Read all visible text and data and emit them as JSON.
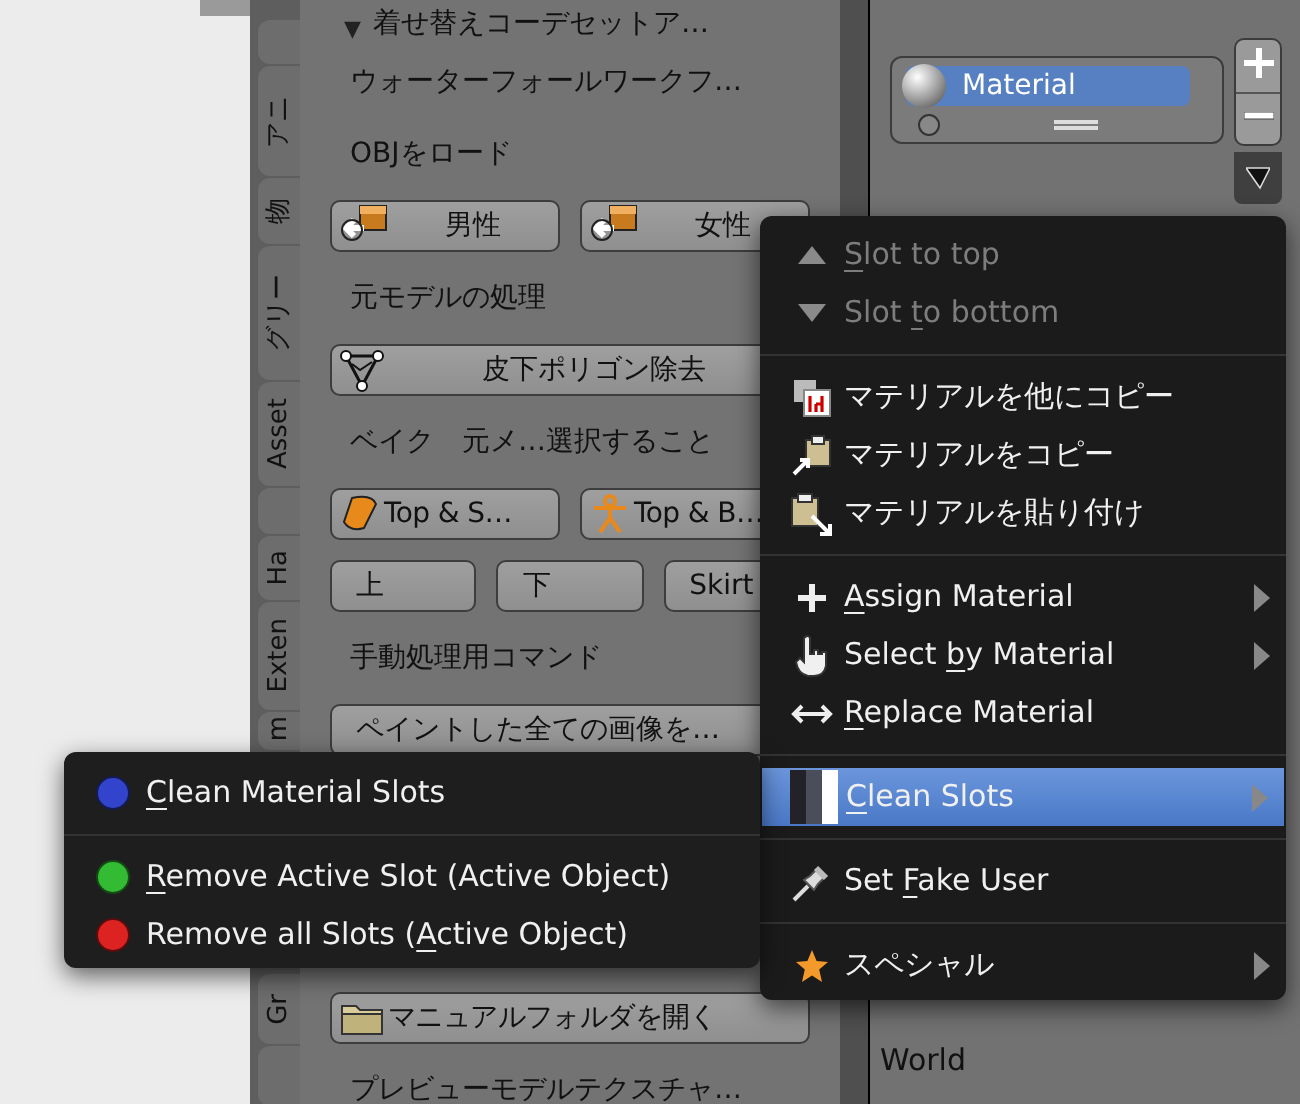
{
  "side_tabs": [
    {
      "kind": "blank"
    },
    {
      "kind": "labeled",
      "label": "アニ"
    },
    {
      "kind": "labeled",
      "label": "物"
    },
    {
      "kind": "labeled",
      "label": "グリー"
    },
    {
      "kind": "labeled",
      "label": "Asset"
    },
    {
      "kind": "blank"
    },
    {
      "kind": "labeled",
      "label": "Ha"
    },
    {
      "kind": "labeled",
      "label": "Exten"
    },
    {
      "kind": "labeled",
      "label": "m"
    },
    {
      "kind": "labeled",
      "label": "Gr"
    },
    {
      "kind": "blank"
    }
  ],
  "panel": {
    "top_rows": [
      {
        "kind": "header",
        "arrow": "▼",
        "text": "着せ替えコーデセットア…"
      },
      {
        "kind": "label",
        "text": "ウォーターフォールワークフ…"
      },
      {
        "kind": "label",
        "text": "OBJをロード"
      },
      {
        "kind": "buttons",
        "buttons": [
          {
            "label": "男性"
          },
          {
            "label": "女性"
          }
        ]
      },
      {
        "kind": "label",
        "text": "元モデルの処理"
      },
      {
        "kind": "buttons",
        "buttons": [
          {
            "label": "皮下ポリゴン除去"
          }
        ]
      },
      {
        "kind": "label",
        "text": "ベイク　元メ…選択すること"
      },
      {
        "kind": "buttons",
        "buttons": [
          {
            "label": "Top & S…"
          },
          {
            "label": "Top & B…"
          }
        ]
      },
      {
        "kind": "buttons",
        "buttons": [
          {
            "label": "上"
          },
          {
            "label": "下"
          },
          {
            "label": "Skirt"
          }
        ]
      },
      {
        "kind": "label",
        "text": "手動処理用コマンド"
      },
      {
        "kind": "buttons",
        "buttons": [
          {
            "label": "ペイントした全ての画像を…"
          }
        ]
      }
    ],
    "bottom_rows": [
      {
        "kind": "buttons",
        "buttons": [
          {
            "label": "マニュアルフォルダを開く"
          }
        ]
      },
      {
        "kind": "label",
        "text": "プレビューモデルテクスチャ…"
      }
    ]
  },
  "material_list": {
    "items": [
      {
        "name": "Material",
        "selected": true
      }
    ]
  },
  "world": "World",
  "context_menu": [
    {
      "kind": "item",
      "label": "Slot to top",
      "disabled": true,
      "submenu": false,
      "selected": false
    },
    {
      "kind": "item",
      "label": "Slot to bottom",
      "disabled": true,
      "submenu": false,
      "selected": false
    },
    {
      "kind": "separator"
    },
    {
      "kind": "item",
      "label": "マテリアルを他にコピー",
      "disabled": false,
      "submenu": false,
      "selected": false
    },
    {
      "kind": "item",
      "label": "マテリアルをコピー",
      "disabled": false,
      "submenu": false,
      "selected": false
    },
    {
      "kind": "item",
      "label": "マテリアルを貼り付け",
      "disabled": false,
      "submenu": false,
      "selected": false
    },
    {
      "kind": "separator"
    },
    {
      "kind": "item",
      "label": "Assign Material",
      "disabled": false,
      "submenu": true,
      "selected": false
    },
    {
      "kind": "item",
      "label": "Select by Material",
      "disabled": false,
      "submenu": true,
      "selected": false
    },
    {
      "kind": "item",
      "label": "Replace Material",
      "disabled": false,
      "submenu": false,
      "selected": false
    },
    {
      "kind": "separator"
    },
    {
      "kind": "item",
      "label": "Clean Slots",
      "disabled": false,
      "submenu": true,
      "selected": true
    },
    {
      "kind": "separator"
    },
    {
      "kind": "item",
      "label": "Set Fake User",
      "disabled": false,
      "submenu": false,
      "selected": false
    },
    {
      "kind": "separator"
    },
    {
      "kind": "item",
      "label": "スペシャル",
      "disabled": false,
      "submenu": true,
      "selected": false
    }
  ],
  "submenu": [
    {
      "kind": "item",
      "label": "Clean Material Slots",
      "color": "#3344cc"
    },
    {
      "kind": "separator"
    },
    {
      "kind": "item",
      "label": "Remove Active Slot (Active Object)",
      "color": "#33bb33"
    },
    {
      "kind": "item",
      "label": "Remove all Slots (Active Object)",
      "color": "#dd2222"
    }
  ]
}
